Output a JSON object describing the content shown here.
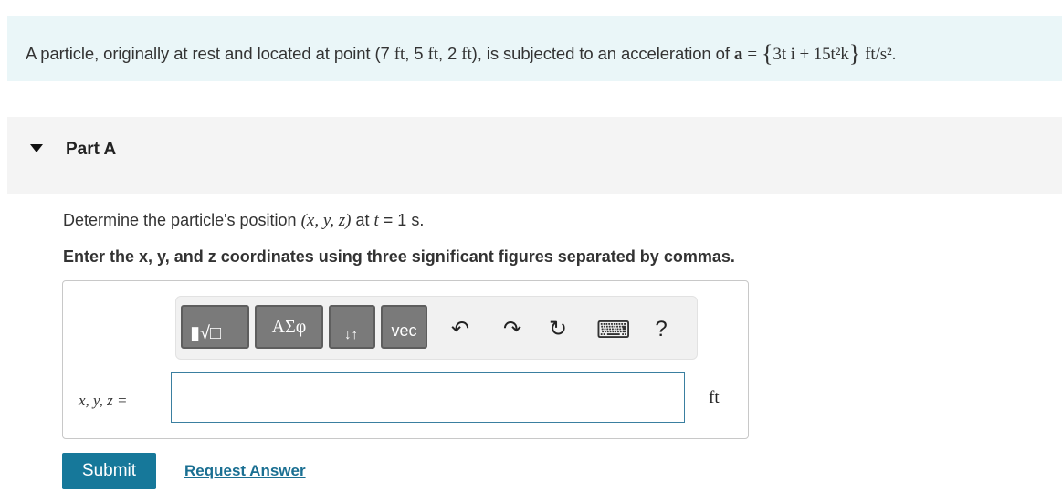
{
  "problem": {
    "text_before": "A particle, originally at rest and located at point (7",
    "ft1": "ft",
    "sep1": ", 5",
    "ft2": "ft",
    "sep2": ", 2",
    "ft3": "ft",
    "text_mid": "), is subjected to an acceleration of",
    "a_symbol": "a",
    "equals": "=",
    "acc_open": "{",
    "acc_expr": "3t i + 15t²k",
    "acc_close": "}",
    "acc_unit": "ft/s²."
  },
  "part": {
    "title": "Part A"
  },
  "question": {
    "lead": "Determine the particle's position",
    "coords": "(x, y, z)",
    "at": "at",
    "t_var": "t",
    "t_value": "= 1 s."
  },
  "instruction": "Enter the x, y, and z coordinates using three significant figures separated by commas.",
  "toolbar": {
    "templates_label": "▮√□",
    "greek_label": "ΑΣφ",
    "arrows_label": "↓↑",
    "vec_label": "vec",
    "undo_icon": "↶",
    "redo_icon": "↷",
    "reset_icon": "↻",
    "keyboard_icon": "⌨",
    "help_label": "?"
  },
  "answer": {
    "label": "x, y, z =",
    "value": "",
    "unit": "ft"
  },
  "buttons": {
    "submit": "Submit",
    "request_answer": "Request Answer"
  }
}
